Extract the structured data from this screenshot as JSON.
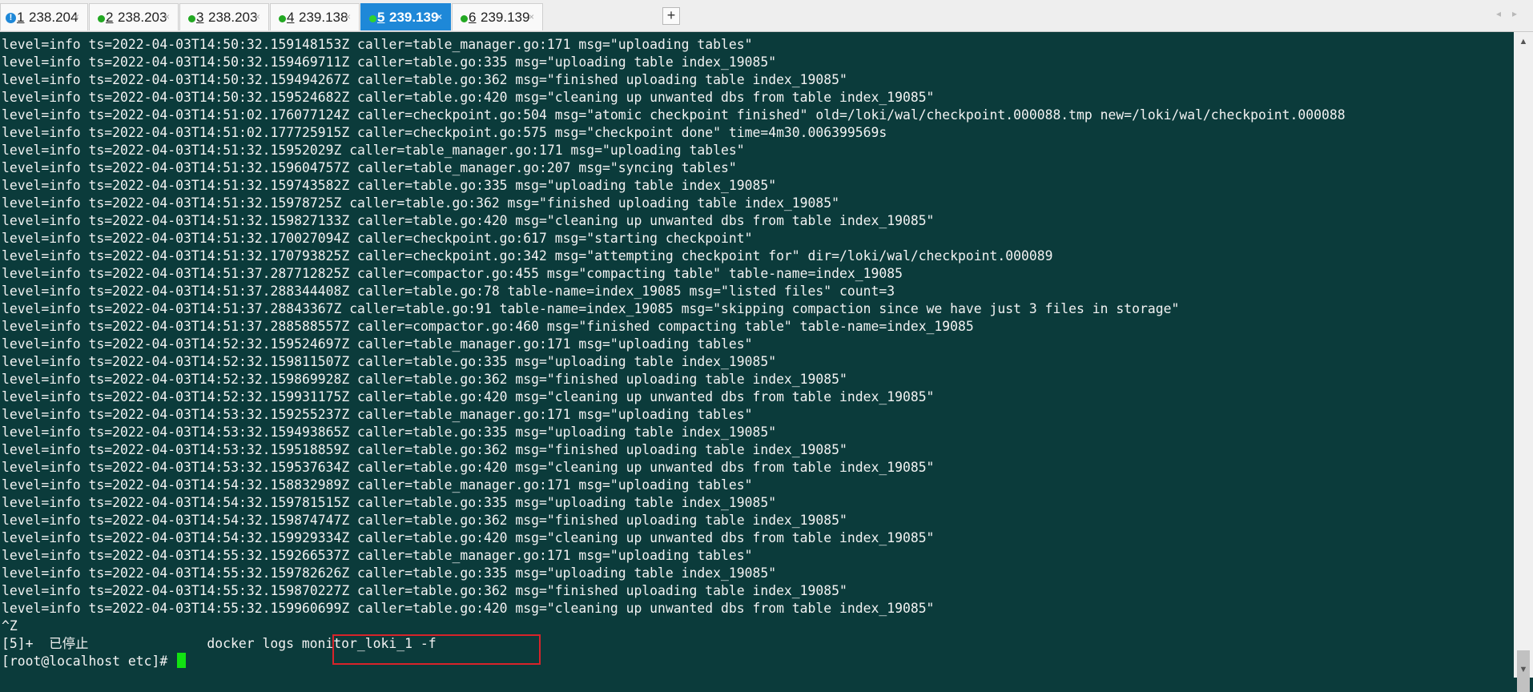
{
  "tabs": [
    {
      "num": "1",
      "host": "238.204",
      "status": "warning",
      "status_color": "#1e88d8",
      "status_glyph": "!"
    },
    {
      "num": "2",
      "host": "238.203",
      "status": "connected",
      "status_color": "#22a822"
    },
    {
      "num": "3",
      "host": "238.203",
      "status": "connected",
      "status_color": "#22a822"
    },
    {
      "num": "4",
      "host": "239.138",
      "status": "connected",
      "status_color": "#22a822"
    },
    {
      "num": "5",
      "host": "239.139",
      "status": "connected",
      "status_color": "#22a822",
      "active": true
    },
    {
      "num": "6",
      "host": "239.139",
      "status": "connected",
      "status_color": "#22a822"
    }
  ],
  "add_tab_label": "+",
  "tab_close_glyph": "×",
  "terminal": {
    "lines": [
      "level=info ts=2022-04-03T14:50:32.159148153Z caller=table_manager.go:171 msg=\"uploading tables\"",
      "level=info ts=2022-04-03T14:50:32.159469711Z caller=table.go:335 msg=\"uploading table index_19085\"",
      "level=info ts=2022-04-03T14:50:32.159494267Z caller=table.go:362 msg=\"finished uploading table index_19085\"",
      "level=info ts=2022-04-03T14:50:32.159524682Z caller=table.go:420 msg=\"cleaning up unwanted dbs from table index_19085\"",
      "level=info ts=2022-04-03T14:51:02.176077124Z caller=checkpoint.go:504 msg=\"atomic checkpoint finished\" old=/loki/wal/checkpoint.000088.tmp new=/loki/wal/checkpoint.000088",
      "level=info ts=2022-04-03T14:51:02.177725915Z caller=checkpoint.go:575 msg=\"checkpoint done\" time=4m30.006399569s",
      "level=info ts=2022-04-03T14:51:32.15952029Z caller=table_manager.go:171 msg=\"uploading tables\"",
      "level=info ts=2022-04-03T14:51:32.159604757Z caller=table_manager.go:207 msg=\"syncing tables\"",
      "level=info ts=2022-04-03T14:51:32.159743582Z caller=table.go:335 msg=\"uploading table index_19085\"",
      "level=info ts=2022-04-03T14:51:32.15978725Z caller=table.go:362 msg=\"finished uploading table index_19085\"",
      "level=info ts=2022-04-03T14:51:32.159827133Z caller=table.go:420 msg=\"cleaning up unwanted dbs from table index_19085\"",
      "level=info ts=2022-04-03T14:51:32.170027094Z caller=checkpoint.go:617 msg=\"starting checkpoint\"",
      "level=info ts=2022-04-03T14:51:32.170793825Z caller=checkpoint.go:342 msg=\"attempting checkpoint for\" dir=/loki/wal/checkpoint.000089",
      "level=info ts=2022-04-03T14:51:37.287712825Z caller=compactor.go:455 msg=\"compacting table\" table-name=index_19085",
      "level=info ts=2022-04-03T14:51:37.288344408Z caller=table.go:78 table-name=index_19085 msg=\"listed files\" count=3",
      "level=info ts=2022-04-03T14:51:37.28843367Z caller=table.go:91 table-name=index_19085 msg=\"skipping compaction since we have just 3 files in storage\"",
      "level=info ts=2022-04-03T14:51:37.288588557Z caller=compactor.go:460 msg=\"finished compacting table\" table-name=index_19085",
      "level=info ts=2022-04-03T14:52:32.159524697Z caller=table_manager.go:171 msg=\"uploading tables\"",
      "level=info ts=2022-04-03T14:52:32.159811507Z caller=table.go:335 msg=\"uploading table index_19085\"",
      "level=info ts=2022-04-03T14:52:32.159869928Z caller=table.go:362 msg=\"finished uploading table index_19085\"",
      "level=info ts=2022-04-03T14:52:32.159931175Z caller=table.go:420 msg=\"cleaning up unwanted dbs from table index_19085\"",
      "level=info ts=2022-04-03T14:53:32.159255237Z caller=table_manager.go:171 msg=\"uploading tables\"",
      "level=info ts=2022-04-03T14:53:32.159493865Z caller=table.go:335 msg=\"uploading table index_19085\"",
      "level=info ts=2022-04-03T14:53:32.159518859Z caller=table.go:362 msg=\"finished uploading table index_19085\"",
      "level=info ts=2022-04-03T14:53:32.159537634Z caller=table.go:420 msg=\"cleaning up unwanted dbs from table index_19085\"",
      "level=info ts=2022-04-03T14:54:32.158832989Z caller=table_manager.go:171 msg=\"uploading tables\"",
      "level=info ts=2022-04-03T14:54:32.159781515Z caller=table.go:335 msg=\"uploading table index_19085\"",
      "level=info ts=2022-04-03T14:54:32.159874747Z caller=table.go:362 msg=\"finished uploading table index_19085\"",
      "level=info ts=2022-04-03T14:54:32.159929334Z caller=table.go:420 msg=\"cleaning up unwanted dbs from table index_19085\"",
      "level=info ts=2022-04-03T14:55:32.159266537Z caller=table_manager.go:171 msg=\"uploading tables\"",
      "level=info ts=2022-04-03T14:55:32.159782626Z caller=table.go:335 msg=\"uploading table index_19085\"",
      "level=info ts=2022-04-03T14:55:32.159870227Z caller=table.go:362 msg=\"finished uploading table index_19085\"",
      "level=info ts=2022-04-03T14:55:32.159960699Z caller=table.go:420 msg=\"cleaning up unwanted dbs from table index_19085\"",
      "^Z",
      "[5]+  已停止               docker logs monitor_loki_1 -f"
    ],
    "prompt": "[root@localhost etc]# ",
    "cursor_color": "#12e112",
    "background_color": "#0b3b3b",
    "highlight_color": "#d8232a"
  },
  "scrollbar": {
    "up_glyph": "▲",
    "down_glyph": "▼",
    "position_fraction": 1.0
  },
  "tabbar_nav": {
    "prev_glyph": "◂",
    "next_glyph": "▸"
  }
}
